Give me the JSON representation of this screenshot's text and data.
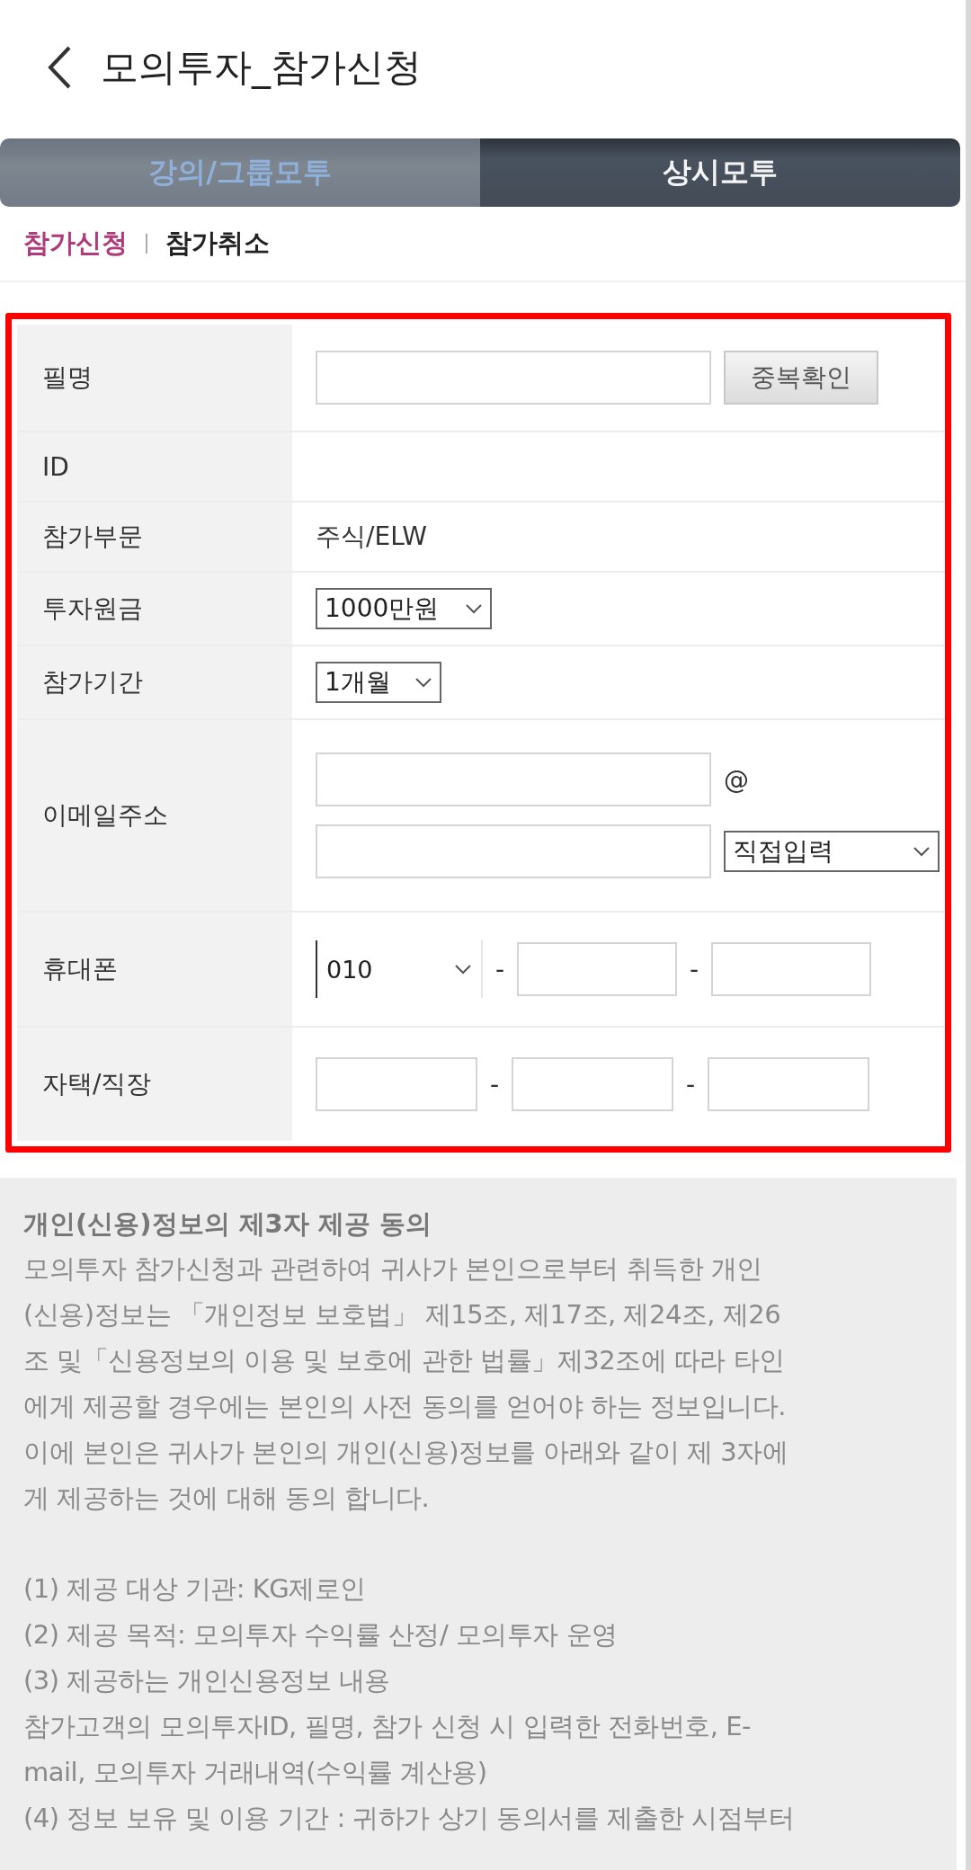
{
  "header": {
    "title": "모의투자_참가신청"
  },
  "tabs": [
    {
      "label": "강의/그룹모투",
      "selected": true
    },
    {
      "label": "상시모투",
      "selected": false
    }
  ],
  "sub_tabs": [
    {
      "label": "참가신청",
      "selected": true
    },
    {
      "label": "참가취소",
      "selected": false
    }
  ],
  "form": {
    "highlighted": true,
    "rows": [
      {
        "kind": "text_button",
        "label": "필명",
        "button": "중복확인"
      },
      {
        "kind": "empty",
        "label": "ID"
      },
      {
        "kind": "value",
        "label": "참가부문",
        "value": "주식/ELW"
      },
      {
        "kind": "select",
        "label": "투자원금",
        "value": "1000만원"
      },
      {
        "kind": "select",
        "label": "참가기간",
        "value": "1개월"
      },
      {
        "kind": "email",
        "label": "이메일주소",
        "at": "@",
        "domain": "직접입력"
      },
      {
        "kind": "phone",
        "label": "휴대폰",
        "prefix": "010",
        "separator": "-"
      },
      {
        "kind": "landline",
        "label": "자택/직장",
        "separator": "-"
      }
    ]
  },
  "agreement": {
    "title": "개인(신용)정보의 제3자 제공 동의",
    "intro": [
      "모의투자 참가신청과 관련하여 귀사가 본인으로부터 취득한 개인",
      "(신용)정보는 「개인정보 보호법」 제15조, 제17조, 제24조, 제26",
      "조 및「신용정보의 이용 및 보호에 관한 법률」제32조에 따라 타인",
      "에게 제공할 경우에는 본인의 사전 동의를 얻어야 하는 정보입니다.",
      "이에 본인은 귀사가 본인의 개인(신용)정보를 아래와 같이 제 3자에",
      "게 제공하는 것에 대해 동의 합니다."
    ],
    "items": [
      "(1) 제공 대상 기관: KG제로인",
      "(2) 제공 목적: 모의투자 수익률 산정/ 모의투자 운영",
      "(3) 제공하는 개인신용정보 내용",
      "참가고객의 모의투자ID, 필명, 참가 신청 시 입력한 전화번호, E-",
      "mail, 모의투자 거래내역(수익률 계산용)",
      "(4) 정보 보유 및 이용 기간 : 귀하가 상기 동의서를 제출한 시점부터"
    ]
  }
}
